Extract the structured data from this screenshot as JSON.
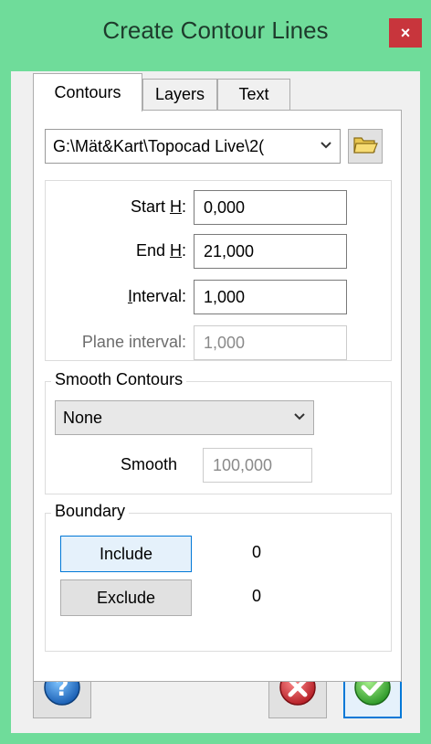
{
  "window": {
    "title": "Create Contour Lines",
    "close_glyph": "×"
  },
  "tabs": [
    {
      "label": "Contours",
      "active": true
    },
    {
      "label": "Layers",
      "active": false
    },
    {
      "label": "Text",
      "active": false
    }
  ],
  "file": {
    "path": "G:\\Mät&Kart\\Topocad Live\\2(",
    "icon": "folder-open-icon"
  },
  "heights": {
    "start_label_pre": "Start ",
    "start_label_ul": "H",
    "start_label_post": ":",
    "start_value": "0,000",
    "end_label_pre": "End ",
    "end_label_ul": "H",
    "end_label_post": ":",
    "end_value": "21,000",
    "interval_label_ul": "I",
    "interval_label_post": "nterval:",
    "interval_value": "1,000",
    "plane_label": "Plane interval:",
    "plane_value": "1,000"
  },
  "smooth": {
    "group_title": "Smooth Contours",
    "method": "None",
    "smooth_label": "Smooth",
    "smooth_value": "100,000"
  },
  "boundary": {
    "group_title": "Boundary",
    "include_label": "Include",
    "include_count": "0",
    "exclude_label": "Exclude",
    "exclude_count": "0"
  },
  "footer": {
    "help_icon": "help-icon",
    "cancel_icon": "cancel-icon",
    "ok_icon": "ok-icon"
  },
  "colors": {
    "window_frame": "#6fdc9a",
    "close_button": "#c8353c",
    "focus_blue": "#0078d7"
  }
}
